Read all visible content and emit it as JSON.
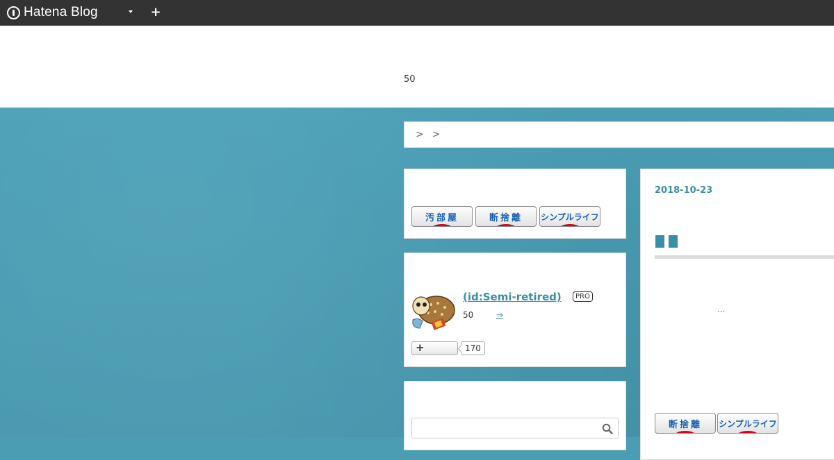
{
  "topbar": {
    "brand": "Hatena Blog",
    "menu_icon": "chevron-down-icon",
    "add_icon": "plus-icon"
  },
  "header": {
    "description": "50"
  },
  "breadcrumb": {
    "items": [
      "",
      ""
    ],
    "separator": ">"
  },
  "sidebar": {
    "banners": [
      "汚部屋",
      "断捨離",
      "シンプルライフ"
    ],
    "profile": {
      "name": " (id:Semi-retired)",
      "badge": "PRO",
      "description": "50",
      "more_link": "⇒",
      "follow_icon": "plus-icon",
      "follow_count": "170"
    },
    "search": {
      "placeholder": "",
      "icon": "search-icon"
    }
  },
  "article": {
    "date": "2018-10-23",
    "excerpt": "...",
    "banners": [
      "断捨離",
      "シンプルライフ"
    ]
  },
  "colors": {
    "topbar": "#333333",
    "background": "#4b9db4",
    "accent": "#3b8fa3",
    "banner_text": "#1560b0",
    "banner_red": "#d8001a"
  }
}
